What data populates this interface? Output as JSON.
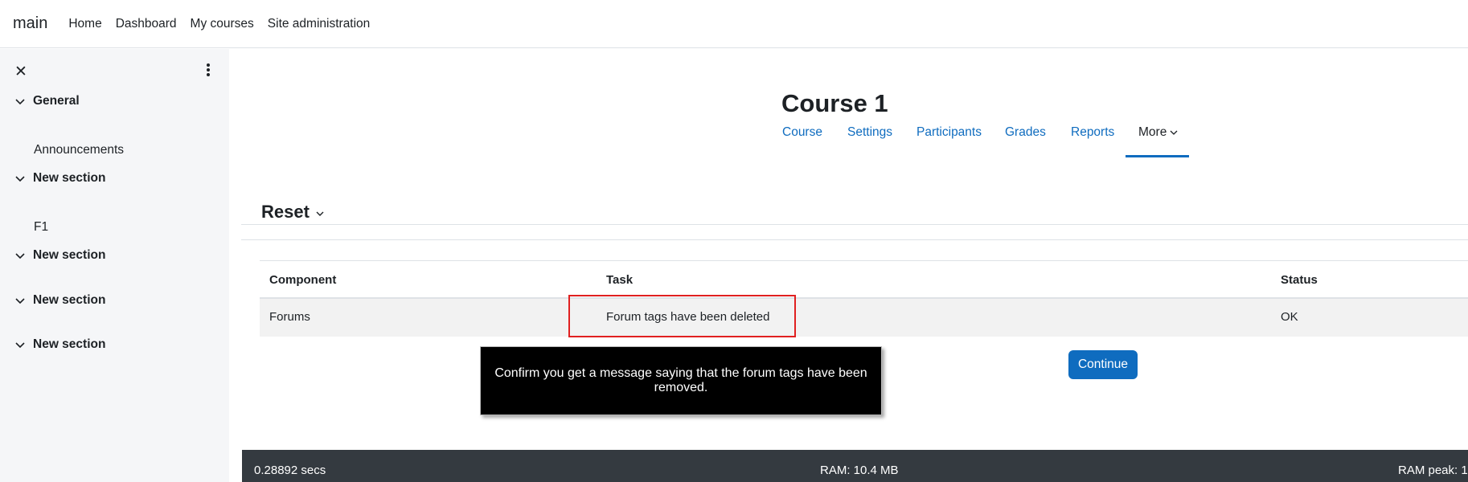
{
  "navbar": {
    "brand": "main",
    "links": [
      "Home",
      "Dashboard",
      "My courses",
      "Site administration"
    ]
  },
  "drawer": {
    "close_icon": "close-icon",
    "menu_icon": "kebab-menu-icon",
    "sections": [
      {
        "title": "General",
        "items": [
          "Announcements"
        ]
      },
      {
        "title": "New section",
        "items": [
          "F1"
        ]
      },
      {
        "title": "New section",
        "items": []
      },
      {
        "title": "New section",
        "items": []
      },
      {
        "title": "New section",
        "items": []
      }
    ]
  },
  "course": {
    "title": "Course 1",
    "tabs": [
      "Course",
      "Settings",
      "Participants",
      "Grades",
      "Reports"
    ],
    "more_label": "More"
  },
  "page": {
    "heading": "Reset"
  },
  "table": {
    "headers": [
      "Component",
      "Task",
      "Status"
    ],
    "rows": [
      {
        "component": "Forums",
        "task": "Forum tags have been deleted",
        "status": "OK"
      }
    ]
  },
  "continue_label": "Continue",
  "tooltip": {
    "text": "Confirm you get a message saying that the forum tags have been removed."
  },
  "footer": {
    "time": "0.28892 secs",
    "ram": "RAM: 10.4 MB",
    "ram_peak": "RAM peak: 1"
  },
  "colors": {
    "accent": "#0f6cbf",
    "drawer_bg": "#f5f6f8",
    "footer_bg": "#343a40",
    "highlight": "#e02020"
  }
}
